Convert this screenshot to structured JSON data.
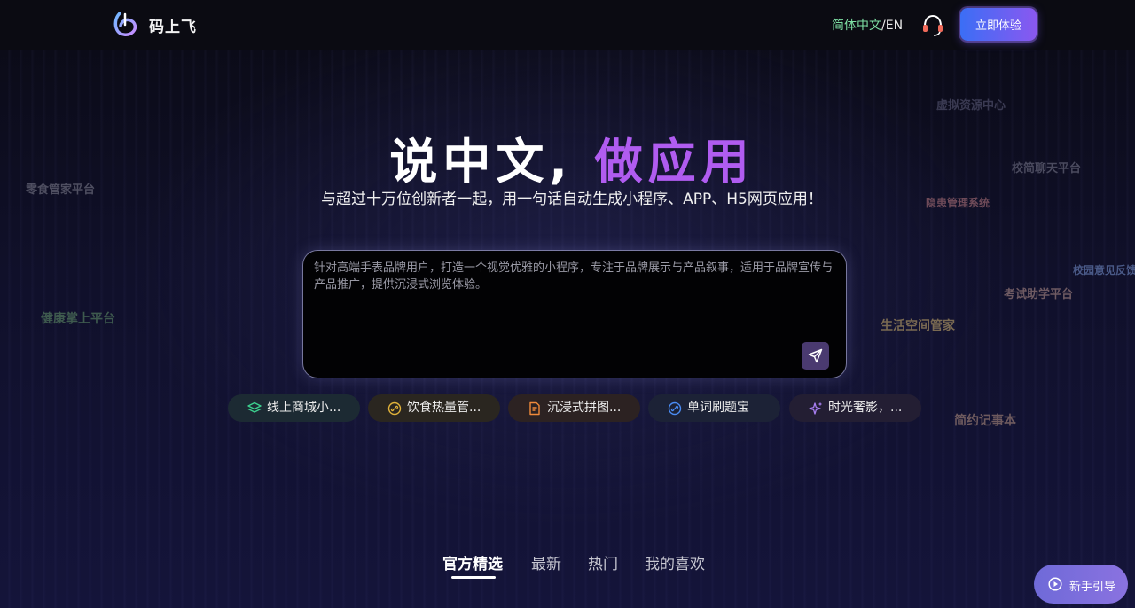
{
  "header": {
    "brand": "码上飞",
    "lang_zh": "简体中文",
    "lang_sep": "/",
    "lang_en": "EN",
    "cta_label": "立即体验"
  },
  "hero": {
    "title_white": "说中文,",
    "title_purple": "做应用",
    "subtitle": "与超过十万位创新者一起，用一句话自动生成小程序、APP、H5网页应用！"
  },
  "floating_tags": [
    {
      "text": "虚拟资源中心",
      "color": "#3a3a52"
    },
    {
      "text": "校简聊天平台",
      "color": "#4a4a5e"
    },
    {
      "text": "零食管家平台",
      "color": "#4e4e60"
    },
    {
      "text": "隐患管理系统",
      "color": "#6e4a58"
    },
    {
      "text": "校园意见反馈",
      "color": "#4a5a88"
    },
    {
      "text": "考试助学平台",
      "color": "#6e5a62"
    },
    {
      "text": "健康掌上平台",
      "color": "#3e5a4e"
    },
    {
      "text": "生活空间管家",
      "color": "#7a6a52"
    },
    {
      "text": "简约记事本",
      "color": "#6e5a5e"
    }
  ],
  "prompt": {
    "value": "针对高端手表品牌用户，打造一个视觉优雅的小程序，专注于品牌展示与产品叙事，适用于品牌宣传与产品推广，提供沉浸式浏览体验。"
  },
  "chips": [
    {
      "label": "线上商城小...",
      "icon": "layers-icon",
      "bg": "#1c2a33",
      "iconColor": "#3ccf8e"
    },
    {
      "label": "饮食热量管...",
      "icon": "link-icon",
      "bg": "#2a2620",
      "iconColor": "#e0b23a"
    },
    {
      "label": "沉浸式拼图...",
      "icon": "document-edit-icon",
      "bg": "#2c2222",
      "iconColor": "#f08a3a"
    },
    {
      "label": "单词刷题宝",
      "icon": "link-icon",
      "bg": "#1c2236",
      "iconColor": "#4a8cf5"
    },
    {
      "label": "时光奢影，...",
      "icon": "sparkle-icon",
      "bg": "#231e33",
      "iconColor": "#a77ef0"
    }
  ],
  "tabs": [
    {
      "label": "官方精选",
      "active": true
    },
    {
      "label": "最新",
      "active": false
    },
    {
      "label": "热门",
      "active": false
    },
    {
      "label": "我的喜欢",
      "active": false
    }
  ],
  "guide": {
    "label": "新手引导"
  },
  "colors": {
    "accent_purple": "#b05cf0",
    "lang_green": "#7ee0a4"
  }
}
